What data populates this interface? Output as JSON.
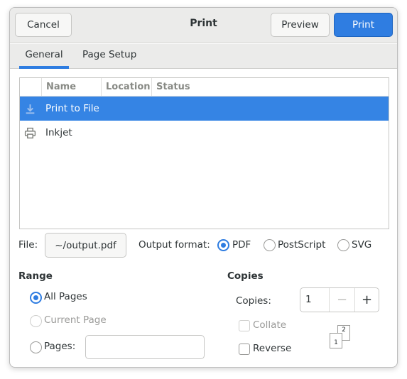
{
  "header": {
    "title": "Print",
    "cancel_label": "Cancel",
    "preview_label": "Preview",
    "print_label": "Print"
  },
  "tabs": [
    {
      "label": "General",
      "active": true
    },
    {
      "label": "Page Setup",
      "active": false
    }
  ],
  "printer_list": {
    "columns": [
      "Name",
      "Location",
      "Status"
    ],
    "rows": [
      {
        "name": "Print to File",
        "icon": "download-icon",
        "selected": true
      },
      {
        "name": "Inkjet",
        "icon": "printer-icon",
        "selected": false
      }
    ]
  },
  "file": {
    "label": "File:",
    "value": "~/output.pdf"
  },
  "output_format": {
    "label": "Output format:",
    "options": [
      "PDF",
      "PostScript",
      "SVG"
    ],
    "selected": "PDF"
  },
  "range": {
    "title": "Range",
    "all_pages": "All Pages",
    "current_page": "Current Page",
    "pages": "Pages:",
    "pages_value": "",
    "selected": "All Pages"
  },
  "copies": {
    "title": "Copies",
    "label": "Copies:",
    "value": "1",
    "minus": "−",
    "plus": "+",
    "collate": "Collate",
    "reverse": "Reverse",
    "page_1": "1",
    "page_2": "2"
  },
  "colors": {
    "accent": "#2f7de1",
    "selection": "#3584e4",
    "headerbar": "#ebebea"
  }
}
